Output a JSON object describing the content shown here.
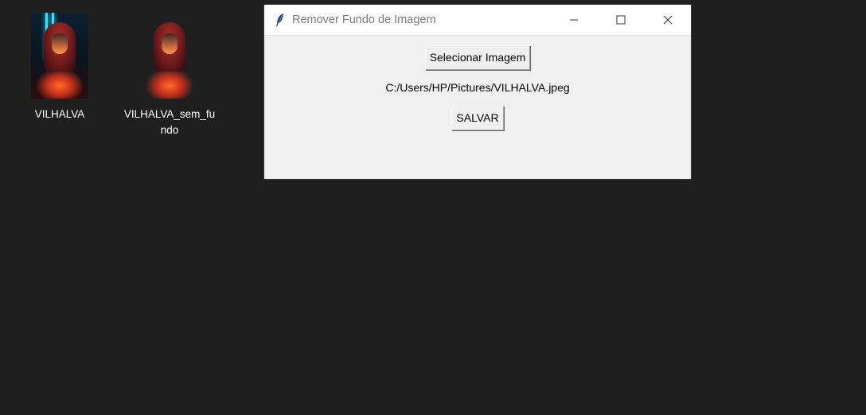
{
  "desktop": {
    "icons": [
      {
        "label": "VILHALVA"
      },
      {
        "label": "VILHALVA_sem_fundo"
      }
    ]
  },
  "window": {
    "title": "Remover Fundo de Imagem",
    "app_icon": "feather-icon",
    "controls": {
      "minimize_icon": "minimize-icon",
      "maximize_icon": "maximize-icon",
      "close_icon": "close-icon"
    },
    "select_button_label": "Selecionar Imagem",
    "file_path": "C:/Users/HP/Pictures/VILHALVA.jpeg",
    "save_button_label": "SALVAR"
  }
}
